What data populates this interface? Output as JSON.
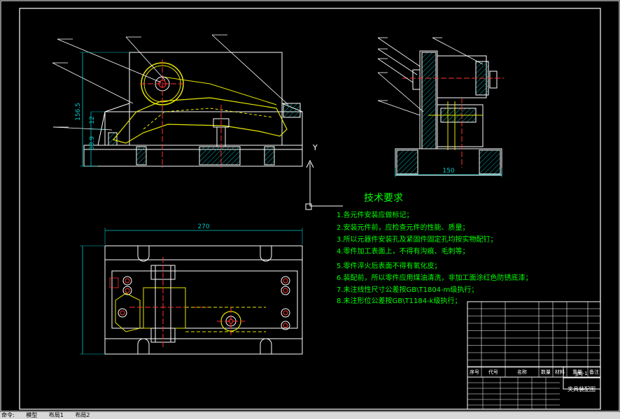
{
  "colors": {
    "background": "#000000",
    "outline": "#ffffff",
    "dimension": "#00c8c8",
    "part_yellow": "#e6e600",
    "hatch": "#00b4b4",
    "centerline": "#ff3030",
    "text_green": "#00ff00",
    "title_block": "#ffffff"
  },
  "drawing": {
    "front_view_dims": {
      "total_height": "156.5",
      "mid_height": "12",
      "lower_height": "58.9"
    },
    "side_view_dims": {
      "width": "150"
    },
    "top_view_dims": {
      "length": "270"
    },
    "ucs_axis_label": "Y"
  },
  "tech_req": {
    "heading": "技术要求",
    "items": [
      "1.各元件安装应做标记；",
      "2.安装元件前，应检查元件的性能、质量；",
      "3.所以元器件安装孔及紧固件固定孔均按实物配钉；",
      "4.零件加工表面上，不得有沟痕、毛刺等；",
      "5.零件淬火后表面不得有氧化皮；",
      "6.装配前，所以零件应用煤油清洗，非加工面涂红色防锈底漆；",
      "7.未注线性尺寸公差按GB\\T1804-m级执行；",
      "8.未注形位公差按GB\\T1184-k级执行；"
    ]
  },
  "title_block": {
    "headers": [
      "序号",
      "代号",
      "名称",
      "数量",
      "材料",
      "重量",
      "备注"
    ],
    "title": "夹具装配图",
    "code": "JJSJ-1"
  },
  "status_bar": {
    "items": [
      "命令:",
      "模型",
      "布局1",
      "布局2"
    ]
  }
}
